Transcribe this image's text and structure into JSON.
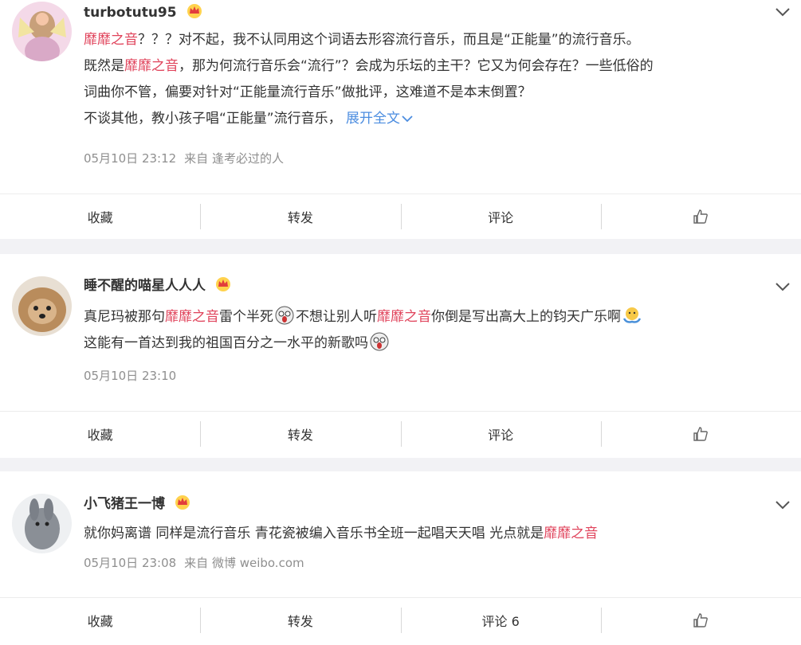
{
  "comments": [
    {
      "username": "turbotutu95",
      "lines": [
        [
          "靡靡之音",
          "？？？对不起，我不认同用这个词语去形容流行音乐，而且是“正能量”的流行音乐。"
        ],
        [
          "既然是",
          "靡靡之音",
          "，那为何流行音乐会“流行”？会成为乐坛的主干？它又为何会存在？一些低俗的"
        ],
        [
          "词曲你不管，偏要对针对“正能量流行音乐”做批评，这难道不是本末倒置？"
        ],
        [
          "不谈其他，教小孩子唱“正能量”流行音乐，",
          "展开全文"
        ]
      ],
      "time": "05月10日 23:12",
      "source": "来自 逢考必过的人",
      "actions": {
        "collect": "收藏",
        "repost": "转发",
        "comment": "评论"
      }
    },
    {
      "username": "睡不醒的喵星人人人",
      "lines": [
        [
          "真尼玛被那句",
          "靡靡之音",
          "雷个半死",
          "不想让别人听",
          "靡靡之音",
          "你倒是写出高大上的钧天广乐啊"
        ],
        [
          "这能有一首达到我的祖国百分之一水平的新歌吗"
        ]
      ],
      "time": "05月10日 23:10",
      "source": "",
      "actions": {
        "collect": "收藏",
        "repost": "转发",
        "comment": "评论"
      }
    },
    {
      "username": "小飞猪王一博",
      "lines": [
        [
          "就你妈离谱 同样是流行音乐 青花瓷被编入音乐书全班一起唱天天唱 光点就是",
          "靡靡之音"
        ]
      ],
      "time": "05月10日 23:08",
      "source": "来自 微博 weibo.com",
      "actions": {
        "collect": "收藏",
        "repost": "转发",
        "comment": "评论 6"
      }
    }
  ],
  "colors": {
    "highlight": "#e0435b",
    "link": "#4c8de0",
    "meta": "#8f8f8f",
    "background": "#f2f2f5"
  }
}
